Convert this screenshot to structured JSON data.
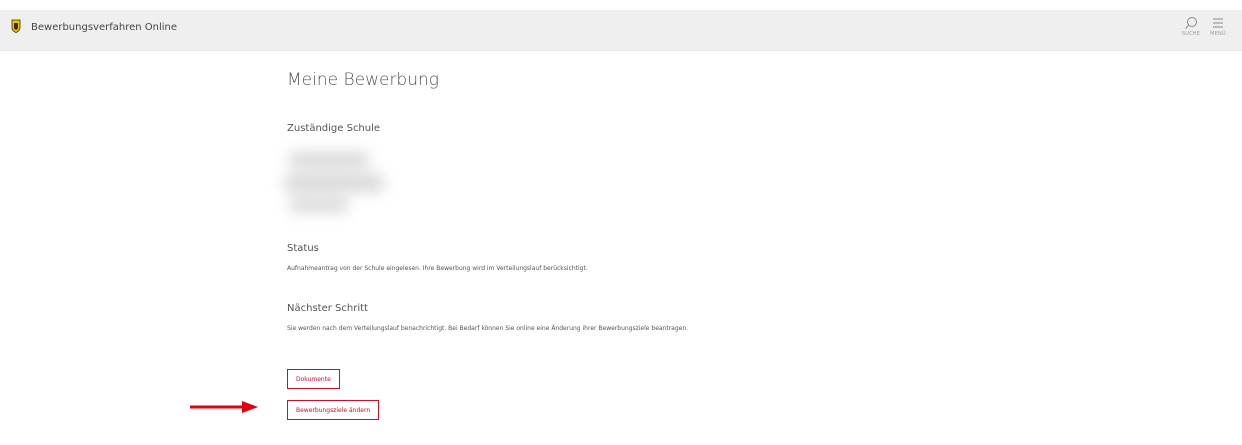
{
  "header": {
    "app_title": "Bewerbungsverfahren Online",
    "search_label": "SUCHE",
    "menu_label": "MENÜ"
  },
  "main": {
    "page_title": "Meine Bewerbung",
    "school_heading": "Zuständige Schule",
    "status_heading": "Status",
    "status_text": "Aufnahmeantrag von der Schule eingelesen. Ihre Bewerbung wird im Verteilungslauf berücksichtigt.",
    "next_step_heading": "Nächster Schritt",
    "next_step_text": "Sie werden nach dem Verteilungslauf benachrichtigt. Bei Bedarf können Sie online eine Änderung ihrer Bewerbungsziele beantragen.",
    "documents_button": "Dokumente",
    "change_goals_button": "Bewerbungsziele ändern"
  },
  "colors": {
    "accent": "#c8102e",
    "arrow": "#e3000f",
    "header_bg": "#efefef"
  }
}
